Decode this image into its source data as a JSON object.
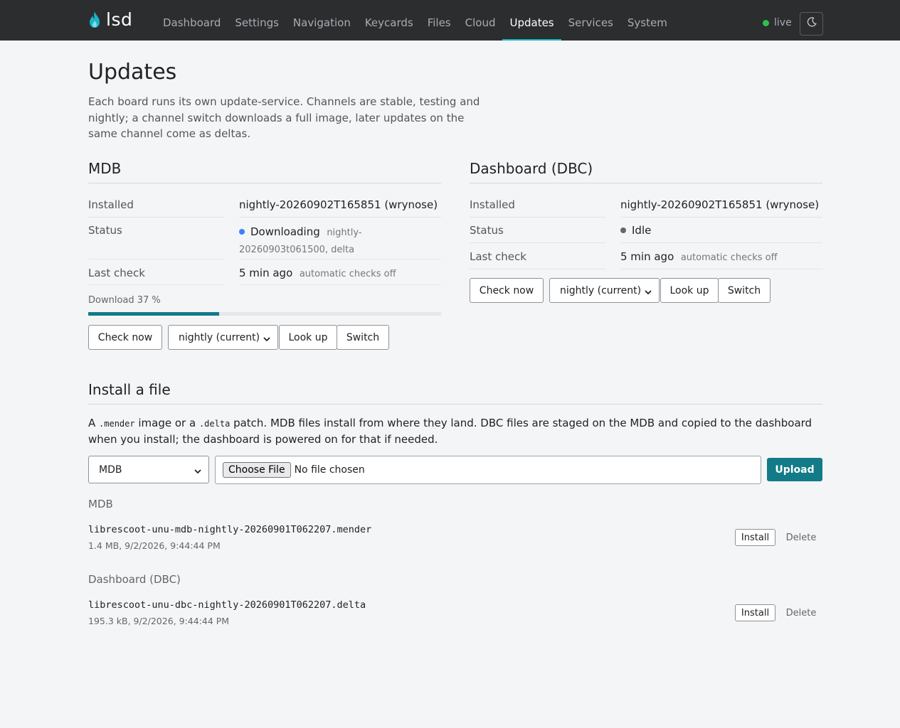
{
  "brand": {
    "name": "lsd",
    "icon": "flame-icon",
    "accent": "#1cb4c8"
  },
  "nav": {
    "items": [
      {
        "label": "Dashboard"
      },
      {
        "label": "Settings"
      },
      {
        "label": "Navigation"
      },
      {
        "label": "Keycards"
      },
      {
        "label": "Files"
      },
      {
        "label": "Cloud"
      },
      {
        "label": "Updates",
        "active": true
      },
      {
        "label": "Services"
      },
      {
        "label": "System"
      }
    ],
    "status": "live",
    "status_color": "#2fbf4f",
    "theme_icon": "moon-icon"
  },
  "page": {
    "title": "Updates",
    "intro": "Each board runs its own update-service. Channels are stable, testing and nightly; a channel switch downloads a full image, later updates on the same channel come as deltas."
  },
  "mdb": {
    "title": "MDB",
    "installed_label": "Installed",
    "installed_value": "nightly-20260902T165851 (wrynose)",
    "status_label": "Status",
    "status_value": "Downloading",
    "status_color": "#3b82f6",
    "status_detail": "nightly-20260903t061500, delta",
    "last_check_label": "Last check",
    "last_check_value": "5 min ago",
    "last_check_note": "automatic checks off",
    "download_label": "Download 37 %",
    "download_progress": 0.37,
    "check_now": "Check now",
    "channel": "nightly (current)",
    "look_up": "Look up",
    "switch": "Switch"
  },
  "dbc": {
    "title": "Dashboard (DBC)",
    "installed_label": "Installed",
    "installed_value": "nightly-20260902T165851 (wrynose)",
    "status_label": "Status",
    "status_value": "Idle",
    "status_color": "#666666",
    "last_check_label": "Last check",
    "last_check_value": "5 min ago",
    "last_check_note": "automatic checks off",
    "check_now": "Check now",
    "channel": "nightly (current)",
    "look_up": "Look up",
    "switch": "Switch"
  },
  "install": {
    "title": "Install a file",
    "desc_1": "A ",
    "desc_code_1": ".mender",
    "desc_2": " image or a ",
    "desc_code_2": ".delta",
    "desc_3": " patch. MDB files install from where they land. DBC files are staged on the MDB and copied to the dashboard when you install; the dashboard is powered on for that if needed.",
    "target": "MDB",
    "choose_file": "Choose File",
    "no_file": "No file chosen",
    "upload": "Upload",
    "groups": [
      {
        "title": "MDB",
        "file": "librescoot-unu-mdb-nightly-20260901T062207.mender",
        "meta": "1.4 MB, 9/2/2026, 9:44:44 PM",
        "install": "Install",
        "delete": "Delete"
      },
      {
        "title": "Dashboard (DBC)",
        "file": "librescoot-unu-dbc-nightly-20260901T062207.delta",
        "meta": "195.3 kB, 9/2/2026, 9:44:44 PM",
        "install": "Install",
        "delete": "Delete"
      }
    ]
  }
}
